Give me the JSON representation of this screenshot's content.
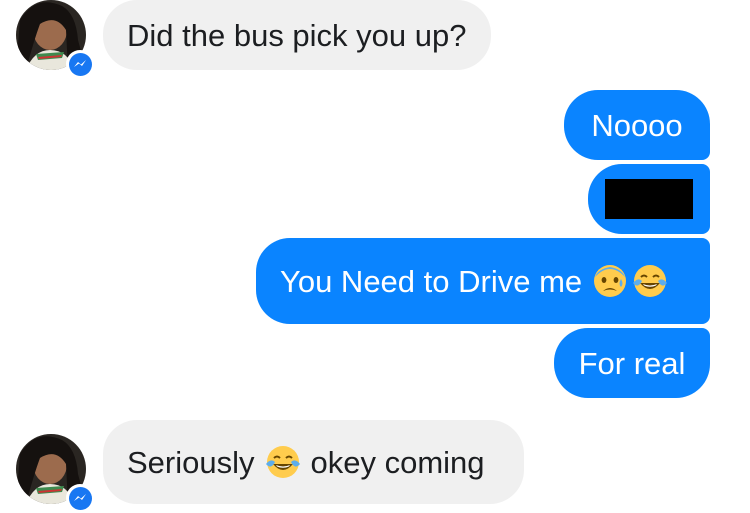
{
  "conversation": {
    "messages": [
      {
        "direction": "incoming",
        "text": "Did the bus pick you up?"
      },
      {
        "direction": "outgoing",
        "text": "Noooo"
      },
      {
        "direction": "outgoing",
        "redacted": true
      },
      {
        "direction": "outgoing",
        "text": "You Need to Drive me",
        "emojis": [
          "anxious-face-with-sweat-icon",
          "face-with-tears-of-joy-icon"
        ]
      },
      {
        "direction": "outgoing",
        "text": "For real"
      },
      {
        "direction": "incoming",
        "text_before": "Seriously",
        "emoji": "face-with-tears-of-joy-icon",
        "text_after": "okey coming"
      }
    ]
  },
  "colors": {
    "outgoing_bubble": "#0a84ff",
    "incoming_bubble": "#f0f0f0",
    "messenger_badge": "#1877f2"
  }
}
